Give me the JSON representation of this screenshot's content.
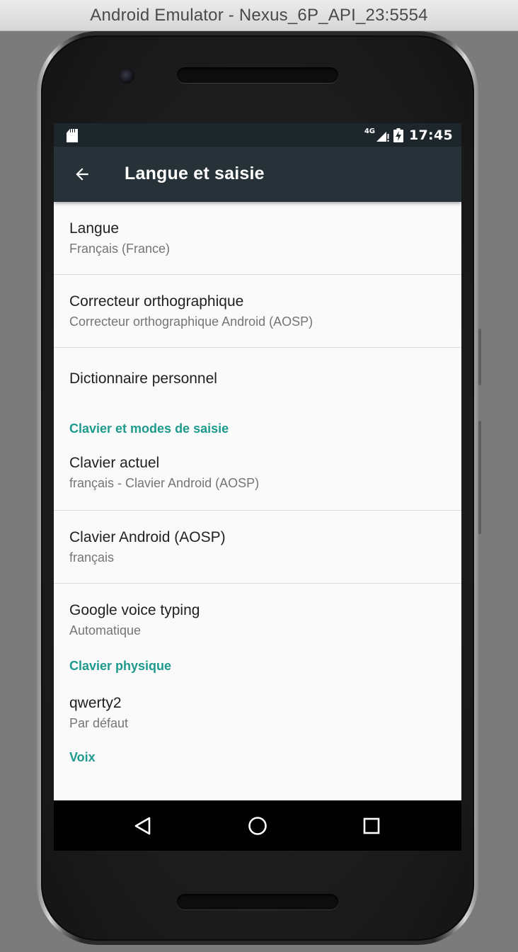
{
  "window": {
    "title": "Android Emulator - Nexus_6P_API_23:5554"
  },
  "status_bar": {
    "network": "4G",
    "time": "17:45",
    "left_icon": "sd-card-icon"
  },
  "app_bar": {
    "title": "Langue et saisie",
    "nav_icon": "arrow-back-icon"
  },
  "preferences": {
    "langue": {
      "title": "Langue",
      "summary": "Français (France)"
    },
    "correcteur": {
      "title": "Correcteur orthographique",
      "summary": "Correcteur orthographique Android (AOSP)"
    },
    "dictionnaire": {
      "title": "Dictionnaire personnel"
    },
    "category_clavier": "Clavier et modes de saisie",
    "clavier_actuel": {
      "title": "Clavier actuel",
      "summary": "français - Clavier Android (AOSP)"
    },
    "clavier_android": {
      "title": "Clavier Android (AOSP)",
      "summary": "français"
    },
    "google_voice": {
      "title": "Google voice typing",
      "summary": "Automatique"
    },
    "category_physique": "Clavier physique",
    "qwerty2": {
      "title": "qwerty2",
      "summary": "Par défaut"
    },
    "category_voix": "Voix"
  },
  "nav_bar": {
    "back": "back-triangle-icon",
    "home": "home-circle-icon",
    "recents": "recents-square-icon"
  },
  "colors": {
    "accent": "#1e9a8c",
    "app_bar": "#263238",
    "status_bar": "#1c262b",
    "background": "#fafafa"
  }
}
